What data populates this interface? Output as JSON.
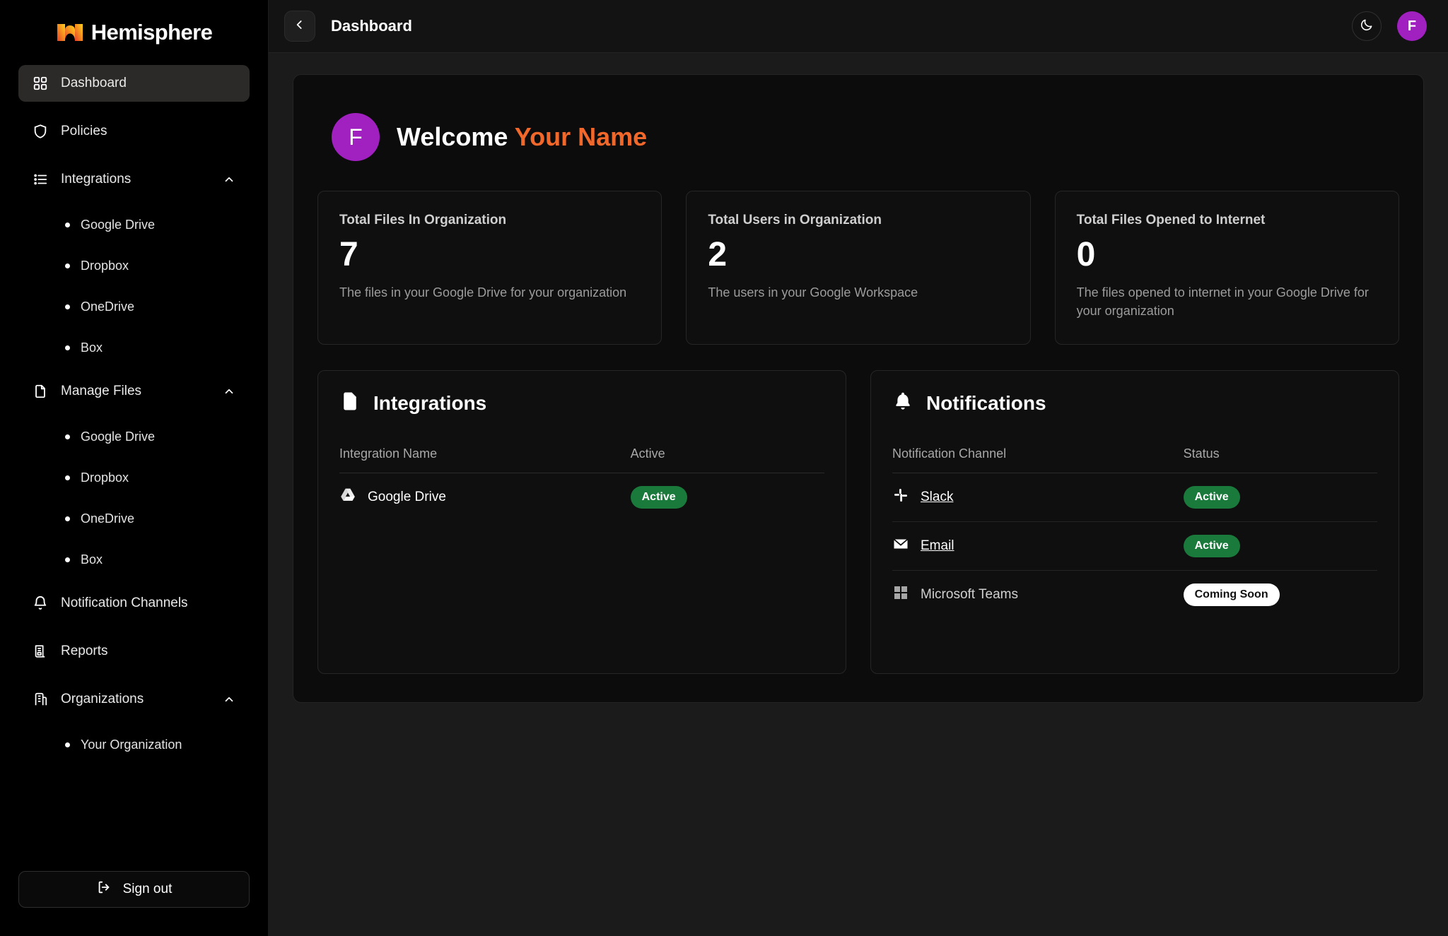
{
  "brand": {
    "name": "Hemisphere",
    "logo_icon": "hemisphere-logo-icon"
  },
  "sidebar": {
    "items": [
      {
        "label": "Dashboard",
        "icon": "grid-icon",
        "active": true
      },
      {
        "label": "Policies",
        "icon": "shield-icon",
        "active": false
      },
      {
        "label": "Integrations",
        "icon": "list-icon",
        "expanded": true,
        "children": [
          "Google Drive",
          "Dropbox",
          "OneDrive",
          "Box"
        ]
      },
      {
        "label": "Manage Files",
        "icon": "file-icon",
        "expanded": true,
        "children": [
          "Google Drive",
          "Dropbox",
          "OneDrive",
          "Box"
        ]
      },
      {
        "label": "Notification Channels",
        "icon": "bell-icon",
        "active": false
      },
      {
        "label": "Reports",
        "icon": "report-icon",
        "active": false
      },
      {
        "label": "Organizations",
        "icon": "building-icon",
        "expanded": true,
        "children": [
          "Your Organization"
        ]
      }
    ],
    "signout_label": "Sign out",
    "signout_icon": "logout-icon"
  },
  "topbar": {
    "collapse_icon": "chevron-left-icon",
    "title": "Dashboard",
    "theme_icon": "moon-icon",
    "avatar_initial": "F"
  },
  "welcome": {
    "avatar_initial": "F",
    "greeting": "Welcome",
    "user_name": "Your Name",
    "accent_color": "#f2682a",
    "avatar_color": "#a020c0"
  },
  "stats": [
    {
      "title": "Total Files In Organization",
      "value": "7",
      "description": "The files in your Google Drive for your organization"
    },
    {
      "title": "Total Users in Organization",
      "value": "2",
      "description": "The users in your Google Workspace"
    },
    {
      "title": "Total Files Opened to Internet",
      "value": "0",
      "description": "The files opened to internet in your Google Drive for your organization"
    }
  ],
  "integrations_panel": {
    "title": "Integrations",
    "icon": "file-icon",
    "columns": [
      "Integration Name",
      "Active"
    ],
    "rows": [
      {
        "name": "Google Drive",
        "icon": "google-drive-icon",
        "status": "Active",
        "status_style": "green"
      }
    ]
  },
  "notifications_panel": {
    "title": "Notifications",
    "icon": "bell-icon",
    "columns": [
      "Notification Channel",
      "Status"
    ],
    "rows": [
      {
        "name": "Slack",
        "icon": "slack-icon",
        "status": "Active",
        "status_style": "green",
        "linked": true
      },
      {
        "name": "Email",
        "icon": "email-icon",
        "status": "Active",
        "status_style": "green",
        "linked": true
      },
      {
        "name": "Microsoft Teams",
        "icon": "microsoft-teams-icon",
        "status": "Coming Soon",
        "status_style": "white",
        "linked": false
      }
    ]
  }
}
